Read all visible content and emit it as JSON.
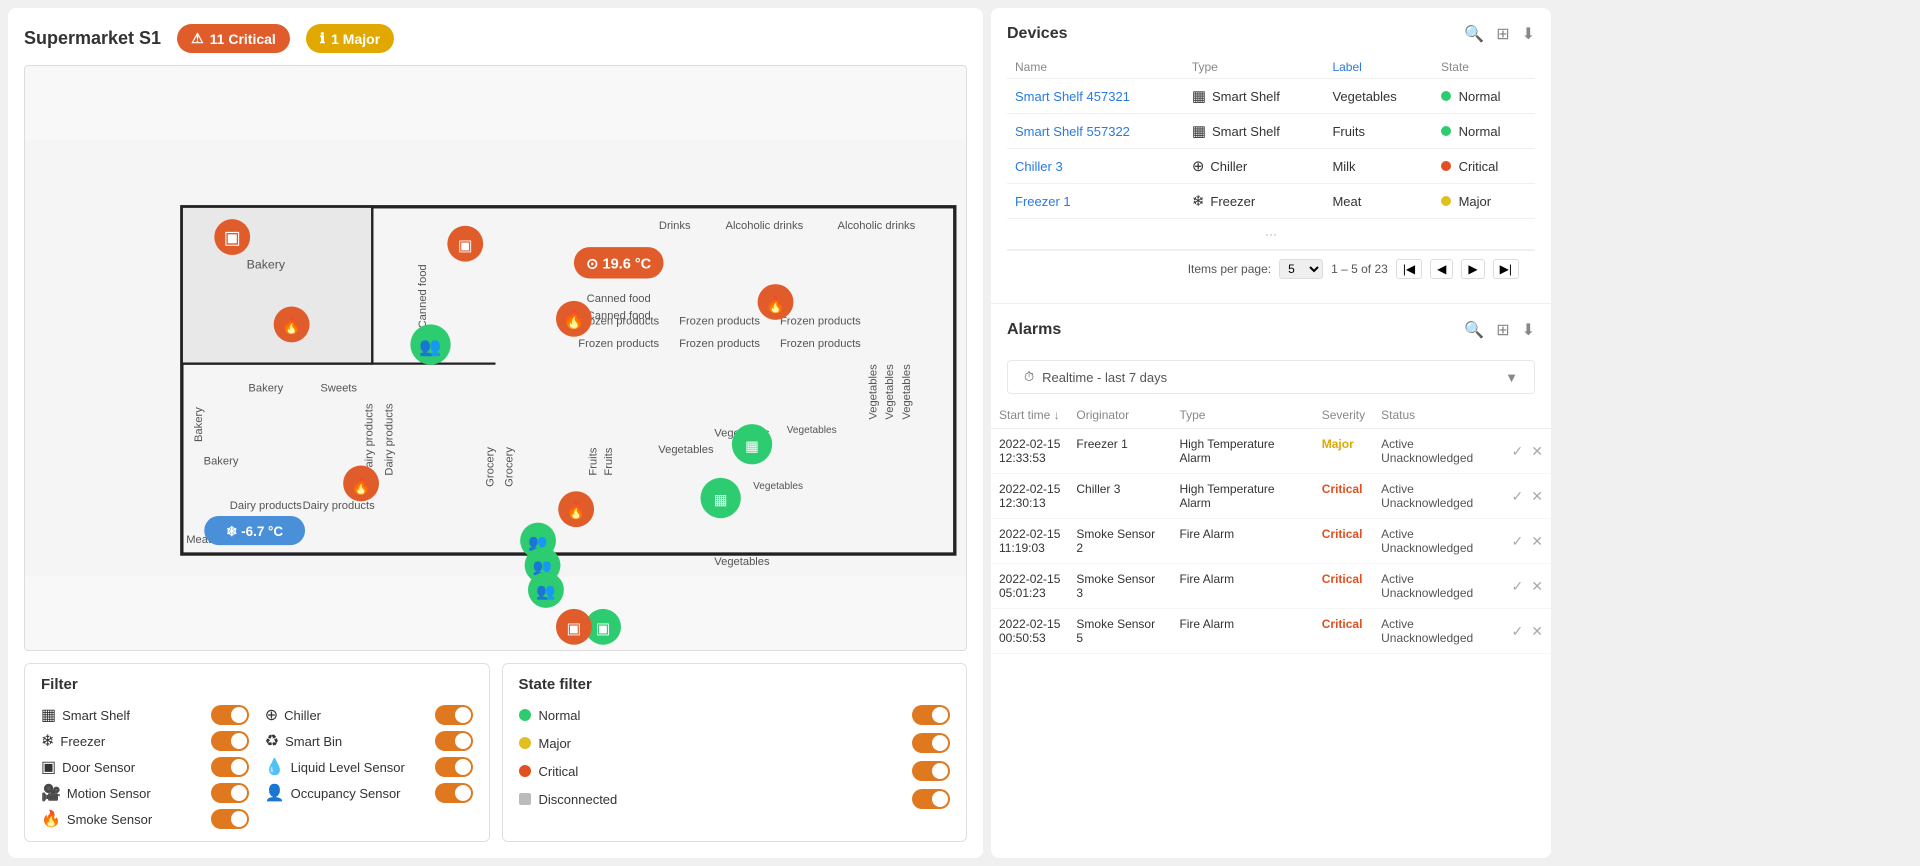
{
  "header": {
    "title": "Supermarket S1",
    "badge_critical_label": "11 Critical",
    "badge_major_label": "1 Major"
  },
  "filter": {
    "title": "Filter",
    "items_col1": [
      {
        "label": "Smart Shelf",
        "icon": "grid-icon",
        "enabled": true
      },
      {
        "label": "Freezer",
        "icon": "snowflake-icon",
        "enabled": true
      },
      {
        "label": "Door Sensor",
        "icon": "door-icon",
        "enabled": true
      },
      {
        "label": "Motion Sensor",
        "icon": "motion-icon",
        "enabled": true
      },
      {
        "label": "Smoke Sensor",
        "icon": "smoke-icon",
        "enabled": true
      }
    ],
    "items_col2": [
      {
        "label": "Chiller",
        "icon": "chiller-icon",
        "enabled": true
      },
      {
        "label": "Smart Bin",
        "icon": "bin-icon",
        "enabled": true
      },
      {
        "label": "Liquid Level Sensor",
        "icon": "liquid-icon",
        "enabled": true
      },
      {
        "label": "Occupancy Sensor",
        "icon": "occupancy-icon",
        "enabled": true
      }
    ]
  },
  "state_filter": {
    "title": "State filter",
    "states": [
      {
        "label": "Normal",
        "color": "#2ecc71",
        "enabled": true
      },
      {
        "label": "Major",
        "color": "#e0c020",
        "enabled": true
      },
      {
        "label": "Critical",
        "color": "#e05020",
        "enabled": true
      },
      {
        "label": "Disconnected",
        "color": "#ccc",
        "enabled": true
      }
    ]
  },
  "devices": {
    "section_title": "Devices",
    "columns": [
      "Name",
      "Type",
      "Label",
      "State"
    ],
    "rows": [
      {
        "name": "Smart Shelf 457321",
        "type": "Smart Shelf",
        "type_icon": "shelf-icon",
        "label": "Vegetables",
        "state": "Normal",
        "state_class": "state-normal"
      },
      {
        "name": "Smart Shelf 557322",
        "type": "Smart Shelf",
        "type_icon": "shelf-icon",
        "label": "Fruits",
        "state": "Normal",
        "state_class": "state-normal"
      },
      {
        "name": "Chiller 3",
        "type": "Chiller",
        "type_icon": "chiller-icon",
        "label": "Milk",
        "state": "Critical",
        "state_class": "state-critical"
      },
      {
        "name": "Freezer 1",
        "type": "Freezer",
        "type_icon": "freezer-icon",
        "label": "Meat",
        "state": "Major",
        "state_class": "state-major"
      },
      {
        "name": "...",
        "type": "...",
        "type_icon": "",
        "label": "...",
        "state": "...",
        "state_class": ""
      }
    ],
    "pagination": {
      "items_per_page_label": "Items per page:",
      "items_per_page": "5",
      "range": "1 – 5 of 23"
    }
  },
  "alarms": {
    "section_title": "Alarms",
    "filter_label": "Realtime - last 7 days",
    "columns": [
      "Start time",
      "Originator",
      "Type",
      "Severity",
      "Status"
    ],
    "rows": [
      {
        "start_time": "2022-02-15\n12:33:53",
        "originator": "Freezer 1",
        "type": "High Temperature Alarm",
        "severity": "Major",
        "severity_class": "severity-major",
        "status": "Active Unacknowledged"
      },
      {
        "start_time": "2022-02-15\n12:30:13",
        "originator": "Chiller 3",
        "type": "High Temperature Alarm",
        "severity": "Critical",
        "severity_class": "severity-critical",
        "status": "Active Unacknowledged"
      },
      {
        "start_time": "2022-02-15\n11:19:03",
        "originator": "Smoke Sensor 2",
        "type": "Fire Alarm",
        "severity": "Critical",
        "severity_class": "severity-critical",
        "status": "Active Unacknowledged"
      },
      {
        "start_time": "2022-02-15\n05:01:23",
        "originator": "Smoke Sensor 3",
        "type": "Fire Alarm",
        "severity": "Critical",
        "severity_class": "severity-critical",
        "status": "Active Unacknowledged"
      },
      {
        "start_time": "2022-02-15\n00:50:53",
        "originator": "Smoke Sensor 5",
        "type": "Fire Alarm",
        "severity": "Critical",
        "severity_class": "severity-critical",
        "status": "Active Unacknowledged"
      }
    ]
  }
}
